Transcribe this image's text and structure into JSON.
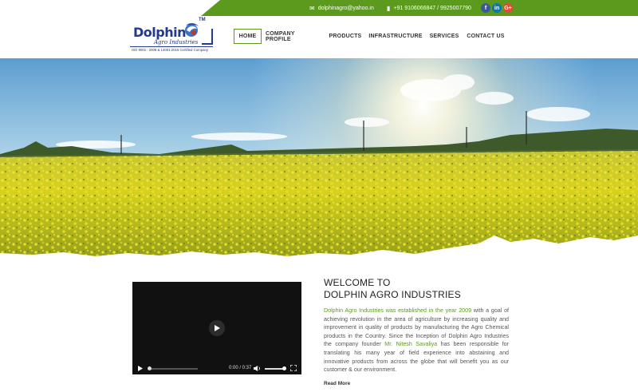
{
  "topbar": {
    "email": "dolphinagro@yahoo.in",
    "phone": "+91 9106066847 / 9925007790",
    "social": {
      "facebook": "f",
      "linkedin": "in",
      "google_plus": "G+"
    }
  },
  "logo": {
    "word_a": "Dolph",
    "word_b": "in",
    "sub": "Agro Industries",
    "tm": "TM",
    "iso": "ISO 9001 : 2008 & 14001:2015 Certified Company"
  },
  "nav": {
    "items": [
      "HOME",
      "COMPANY PROFILE",
      "PRODUCTS",
      "INFRASTRUCTURE",
      "SERVICES",
      "CONTACT US"
    ]
  },
  "video": {
    "time": "0:00 / 0:37",
    "progress": 0
  },
  "welcome": {
    "line1": "WELCOME TO",
    "line2": "DOLPHIN AGRO INDUSTRIES",
    "lead_highlight": "Dolphin Agro Industries was established in the year 2009",
    "text_a": " with a goal of achieving revolution in the area of agriculture by increasing quality and improvement in quality of products by manufacturing the Agro Chemical products in the Country. Since the Inception of Dolphin Agro Industries the company founder ",
    "founder": "Mr. Nitesh Savaliya",
    "text_b": " has been responsible for translating his many year of field experience into abstaining and innovative products from across the globe that will benefit you as our customer & our environment.",
    "read_more": "Read More"
  },
  "colors": {
    "brand_green": "#5b9a1c",
    "brand_blue": "#223a8f",
    "field_yellow": "#d8d21e"
  }
}
